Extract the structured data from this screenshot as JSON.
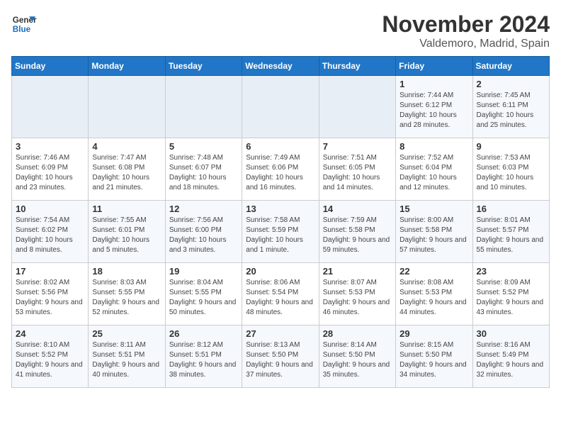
{
  "logo": {
    "text_general": "General",
    "text_blue": "Blue"
  },
  "header": {
    "month": "November 2024",
    "location": "Valdemoro, Madrid, Spain"
  },
  "days_of_week": [
    "Sunday",
    "Monday",
    "Tuesday",
    "Wednesday",
    "Thursday",
    "Friday",
    "Saturday"
  ],
  "weeks": [
    [
      {
        "day": "",
        "info": ""
      },
      {
        "day": "",
        "info": ""
      },
      {
        "day": "",
        "info": ""
      },
      {
        "day": "",
        "info": ""
      },
      {
        "day": "",
        "info": ""
      },
      {
        "day": "1",
        "info": "Sunrise: 7:44 AM\nSunset: 6:12 PM\nDaylight: 10 hours and 28 minutes."
      },
      {
        "day": "2",
        "info": "Sunrise: 7:45 AM\nSunset: 6:11 PM\nDaylight: 10 hours and 25 minutes."
      }
    ],
    [
      {
        "day": "3",
        "info": "Sunrise: 7:46 AM\nSunset: 6:09 PM\nDaylight: 10 hours and 23 minutes."
      },
      {
        "day": "4",
        "info": "Sunrise: 7:47 AM\nSunset: 6:08 PM\nDaylight: 10 hours and 21 minutes."
      },
      {
        "day": "5",
        "info": "Sunrise: 7:48 AM\nSunset: 6:07 PM\nDaylight: 10 hours and 18 minutes."
      },
      {
        "day": "6",
        "info": "Sunrise: 7:49 AM\nSunset: 6:06 PM\nDaylight: 10 hours and 16 minutes."
      },
      {
        "day": "7",
        "info": "Sunrise: 7:51 AM\nSunset: 6:05 PM\nDaylight: 10 hours and 14 minutes."
      },
      {
        "day": "8",
        "info": "Sunrise: 7:52 AM\nSunset: 6:04 PM\nDaylight: 10 hours and 12 minutes."
      },
      {
        "day": "9",
        "info": "Sunrise: 7:53 AM\nSunset: 6:03 PM\nDaylight: 10 hours and 10 minutes."
      }
    ],
    [
      {
        "day": "10",
        "info": "Sunrise: 7:54 AM\nSunset: 6:02 PM\nDaylight: 10 hours and 8 minutes."
      },
      {
        "day": "11",
        "info": "Sunrise: 7:55 AM\nSunset: 6:01 PM\nDaylight: 10 hours and 5 minutes."
      },
      {
        "day": "12",
        "info": "Sunrise: 7:56 AM\nSunset: 6:00 PM\nDaylight: 10 hours and 3 minutes."
      },
      {
        "day": "13",
        "info": "Sunrise: 7:58 AM\nSunset: 5:59 PM\nDaylight: 10 hours and 1 minute."
      },
      {
        "day": "14",
        "info": "Sunrise: 7:59 AM\nSunset: 5:58 PM\nDaylight: 9 hours and 59 minutes."
      },
      {
        "day": "15",
        "info": "Sunrise: 8:00 AM\nSunset: 5:58 PM\nDaylight: 9 hours and 57 minutes."
      },
      {
        "day": "16",
        "info": "Sunrise: 8:01 AM\nSunset: 5:57 PM\nDaylight: 9 hours and 55 minutes."
      }
    ],
    [
      {
        "day": "17",
        "info": "Sunrise: 8:02 AM\nSunset: 5:56 PM\nDaylight: 9 hours and 53 minutes."
      },
      {
        "day": "18",
        "info": "Sunrise: 8:03 AM\nSunset: 5:55 PM\nDaylight: 9 hours and 52 minutes."
      },
      {
        "day": "19",
        "info": "Sunrise: 8:04 AM\nSunset: 5:55 PM\nDaylight: 9 hours and 50 minutes."
      },
      {
        "day": "20",
        "info": "Sunrise: 8:06 AM\nSunset: 5:54 PM\nDaylight: 9 hours and 48 minutes."
      },
      {
        "day": "21",
        "info": "Sunrise: 8:07 AM\nSunset: 5:53 PM\nDaylight: 9 hours and 46 minutes."
      },
      {
        "day": "22",
        "info": "Sunrise: 8:08 AM\nSunset: 5:53 PM\nDaylight: 9 hours and 44 minutes."
      },
      {
        "day": "23",
        "info": "Sunrise: 8:09 AM\nSunset: 5:52 PM\nDaylight: 9 hours and 43 minutes."
      }
    ],
    [
      {
        "day": "24",
        "info": "Sunrise: 8:10 AM\nSunset: 5:52 PM\nDaylight: 9 hours and 41 minutes."
      },
      {
        "day": "25",
        "info": "Sunrise: 8:11 AM\nSunset: 5:51 PM\nDaylight: 9 hours and 40 minutes."
      },
      {
        "day": "26",
        "info": "Sunrise: 8:12 AM\nSunset: 5:51 PM\nDaylight: 9 hours and 38 minutes."
      },
      {
        "day": "27",
        "info": "Sunrise: 8:13 AM\nSunset: 5:50 PM\nDaylight: 9 hours and 37 minutes."
      },
      {
        "day": "28",
        "info": "Sunrise: 8:14 AM\nSunset: 5:50 PM\nDaylight: 9 hours and 35 minutes."
      },
      {
        "day": "29",
        "info": "Sunrise: 8:15 AM\nSunset: 5:50 PM\nDaylight: 9 hours and 34 minutes."
      },
      {
        "day": "30",
        "info": "Sunrise: 8:16 AM\nSunset: 5:49 PM\nDaylight: 9 hours and 32 minutes."
      }
    ]
  ]
}
